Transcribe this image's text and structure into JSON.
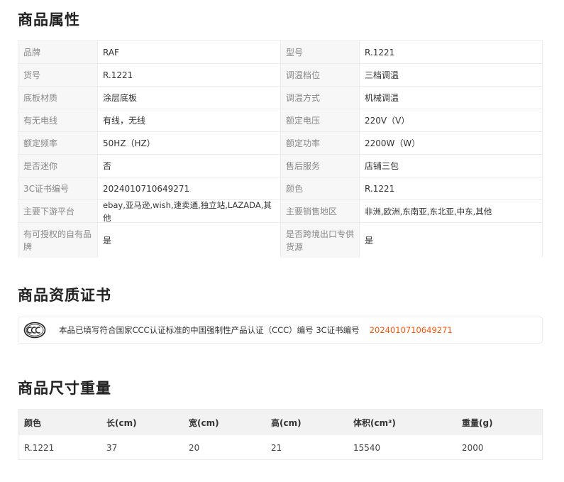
{
  "sections": {
    "attributes_title": "商品属性",
    "certificate_title": "商品资质证书",
    "size_title": "商品尺寸重量"
  },
  "attributes": [
    {
      "k1": "品牌",
      "v1": "RAF",
      "k2": "型号",
      "v2": "R.1221"
    },
    {
      "k1": "货号",
      "v1": "R.1221",
      "k2": "调温档位",
      "v2": "三档调温"
    },
    {
      "k1": "底板材质",
      "v1": "涂层底板",
      "k2": "调温方式",
      "v2": "机械调温"
    },
    {
      "k1": "有无电线",
      "v1": "有线，无线",
      "k2": "额定电压",
      "v2": "220V（V）"
    },
    {
      "k1": "额定频率",
      "v1": "50HZ（HZ）",
      "k2": "额定功率",
      "v2": "2200W（W）"
    },
    {
      "k1": "是否迷你",
      "v1": "否",
      "k2": "售后服务",
      "v2": "店铺三包"
    },
    {
      "k1": "3C证书编号",
      "v1": "2024010710649271",
      "k2": "颜色",
      "v2": "R.1221"
    },
    {
      "k1": "主要下游平台",
      "v1": "ebay,亚马逊,wish,速卖通,独立站,LAZADA,其他",
      "k2": "主要销售地区",
      "v2": "非洲,欧洲,东南亚,东北亚,中东,其他"
    },
    {
      "k1": "有可授权的自有品牌",
      "v1": "是",
      "k2": "是否跨境出口专供货源",
      "v2": "是"
    }
  ],
  "certificate": {
    "icon": "ccc-icon",
    "text": "本品已填写符合国家CCC认证标准的中国强制性产品认证（CCC）编号 3C证书编号",
    "number": "2024010710649271",
    "number_color": "#ff5000"
  },
  "size_table": {
    "headers": [
      "颜色",
      "长(cm)",
      "宽(cm)",
      "高(cm)",
      "体积(cm³)",
      "重量(g)"
    ],
    "rows": [
      [
        "R.1221",
        "37",
        "20",
        "21",
        "15540",
        "2000"
      ]
    ]
  }
}
